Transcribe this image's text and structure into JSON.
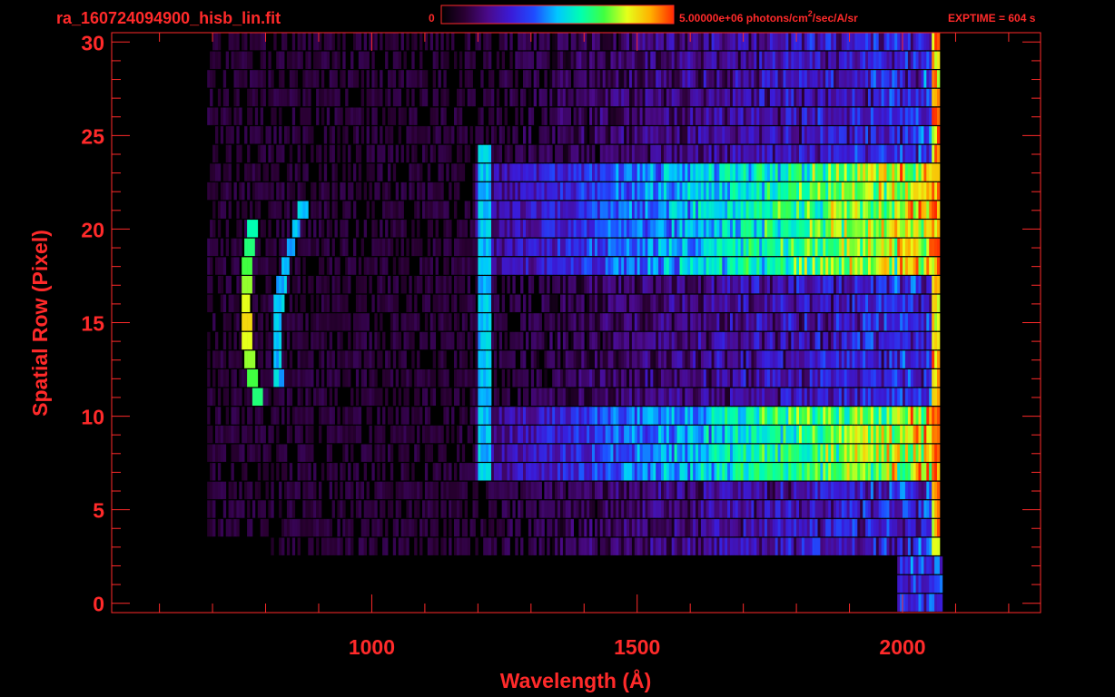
{
  "colors": {
    "axis": "#ff2a2a",
    "background": "#000000",
    "colormap": [
      "#000000",
      "#2a0033",
      "#4a0a8a",
      "#3a1bd8",
      "#1f4cff",
      "#00c8ff",
      "#00ffb0",
      "#40ff40",
      "#e6ff1a",
      "#ffb000",
      "#ff2a00"
    ]
  },
  "header": {
    "filename": "ra_160724094900_hisb_lin.fit",
    "colorbar_min_label": "0",
    "colorbar_max_label": "5.00000e+06 photons/cm",
    "colorbar_units_sup": "2",
    "colorbar_units_rest": "/sec/A/sr",
    "exptime": "EXPTIME = 604 s"
  },
  "chart_data": {
    "type": "heatmap",
    "title": "ra_160724094900_hisb_lin.fit",
    "xlabel": "Wavelength (Å)",
    "ylabel": "Spatial Row (Pixel)",
    "xlim": [
      510,
      2260
    ],
    "ylim": [
      -0.5,
      30.5
    ],
    "x_ticks": [
      1000,
      1500,
      2000
    ],
    "x_tick_labels": [
      "1000",
      "1500",
      "2000"
    ],
    "y_ticks": [
      0,
      5,
      10,
      15,
      20,
      25,
      30
    ],
    "y_tick_labels": [
      "0",
      "5",
      "10",
      "15",
      "20",
      "25",
      "30"
    ],
    "x_minor_step": 100,
    "y_minor_step": 1,
    "colorbar": {
      "min": 0,
      "max": 5000000,
      "units": "photons/cm^2/sec/A/sr"
    },
    "exptime_s": 604,
    "grid": false,
    "features": [
      {
        "name": "curved emission arc",
        "x_range": [
          760,
          830
        ],
        "rows": [
          11,
          20
        ],
        "peak_fraction": 0.85
      },
      {
        "name": "second arc",
        "x_range": [
          820,
          880
        ],
        "rows": [
          12,
          21
        ],
        "peak_fraction": 0.55
      },
      {
        "name": "vertical line",
        "x": 1210,
        "rows": [
          7,
          24
        ],
        "peak_fraction": 0.5
      },
      {
        "name": "bright continuum band",
        "x_range": [
          1200,
          2050
        ],
        "rows": [
          18,
          23
        ],
        "peak_fraction": 0.75
      },
      {
        "name": "bright continuum band",
        "x_range": [
          1200,
          2050
        ],
        "rows": [
          7,
          10
        ],
        "peak_fraction": 0.75
      }
    ]
  }
}
